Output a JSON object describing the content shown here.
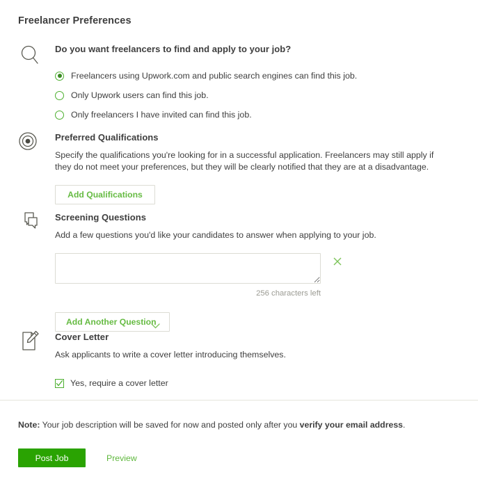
{
  "header": {
    "title": "Freelancer Preferences"
  },
  "sections": {
    "visibility": {
      "icon": "search-icon",
      "heading": "Do you want freelancers to find and apply to your job?",
      "options": [
        {
          "label": "Freelancers using Upwork.com and public search engines can find this job.",
          "checked": true
        },
        {
          "label": "Only Upwork users can find this job.",
          "checked": false
        },
        {
          "label": "Only freelancers I have invited can find this job.",
          "checked": false
        }
      ]
    },
    "qualifications": {
      "icon": "target-icon",
      "heading": "Preferred Qualifications",
      "description": "Specify the qualifications you're looking for in a successful application. Freelancers may still apply if they do not meet your preferences, but they will be clearly notified that they are at a disadvantage.",
      "add_button": "Add Qualifications"
    },
    "screening": {
      "icon": "chat-bubbles-icon",
      "heading": "Screening Questions",
      "description": "Add a few questions you'd like your candidates to answer when applying to your job.",
      "question_value": "",
      "question_placeholder": "",
      "remove_icon": "close-x-icon",
      "characters_left": "256 characters left",
      "add_another": "Add Another Question",
      "dropdown_icon": "chevron-down-icon"
    },
    "cover_letter": {
      "icon": "document-pencil-icon",
      "heading": "Cover Letter",
      "description": "Ask applicants to write a cover letter introducing themselves.",
      "checkbox_label": "Yes, require a cover letter",
      "checkbox_checked": true
    }
  },
  "footer": {
    "note_prefix": "Note:",
    "note_body": " Your job description will be saved for now and posted only after you ",
    "note_emphasis": "verify your email address",
    "note_suffix": ".",
    "post_button": "Post Job",
    "preview_link": "Preview"
  },
  "colors": {
    "brand_green": "#2aa302",
    "link_green": "#5fb83d",
    "control_green": "#4caf2e",
    "text": "#3e3e3e",
    "muted": "#9b9b93",
    "border": "#dcdcd4"
  }
}
